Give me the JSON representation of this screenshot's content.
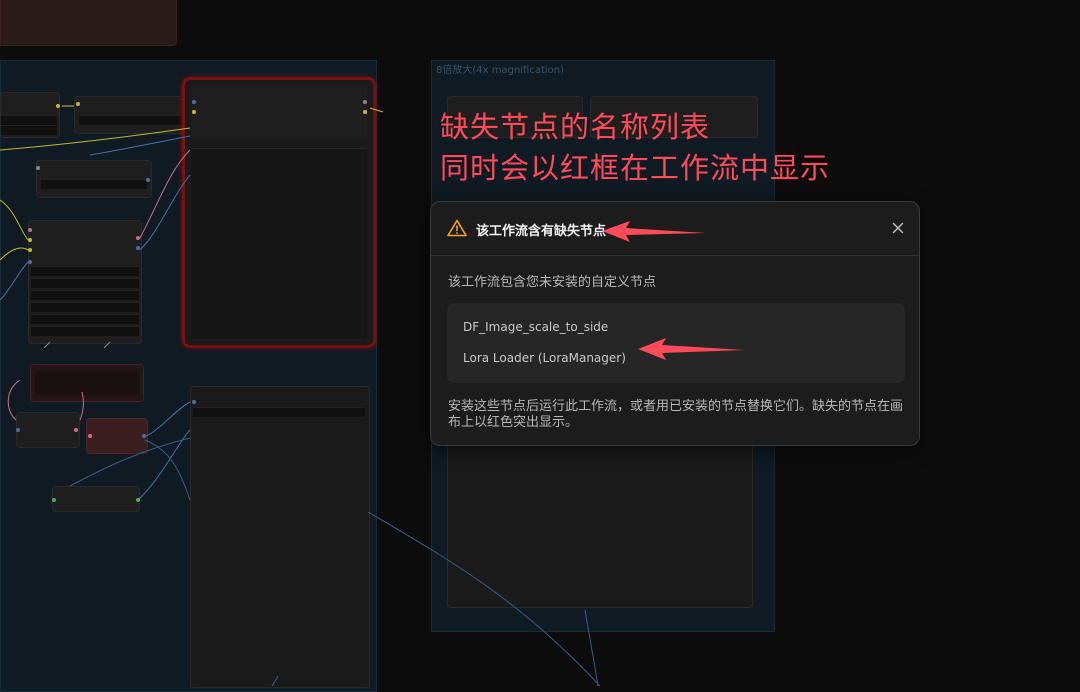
{
  "canvas": {
    "group_title": "8倍放大(4x magnification)"
  },
  "annotation": {
    "line1": "缺失节点的名称列表",
    "line2": "同时会以红框在工作流中显示",
    "color": "#ff4a5a"
  },
  "dialog": {
    "title": "该工作流含有缺失节点",
    "description": "该工作流包含您未安装的自定义节点",
    "missing_nodes": [
      "DF_Image_scale_to_side",
      "Lora Loader (LoraManager)"
    ],
    "footer": "安装这些节点后运行此工作流，或者用已安装的节点替换它们。缺失的节点在画布上以红色突出显示。",
    "warning_color": "#f5a524",
    "icons": {
      "warning": "warning-triangle-icon",
      "close": "close-icon"
    }
  }
}
